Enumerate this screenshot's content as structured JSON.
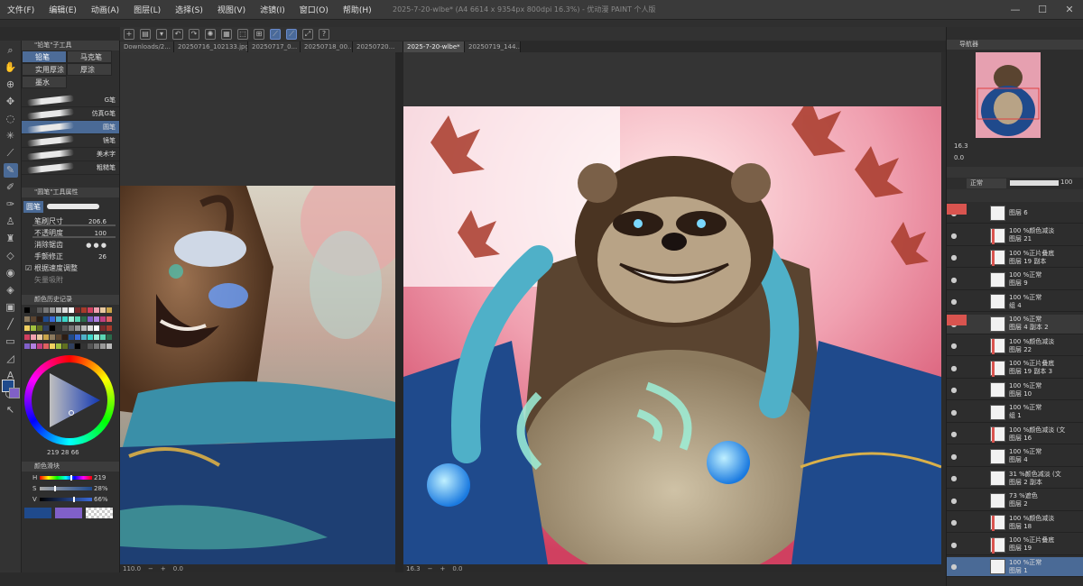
{
  "window": {
    "title": "2025-7-20-wlbe* (A4 6614 x 9354px 800dpi 16.3%) - 优动漫 PAINT 个人版"
  },
  "menu": [
    "文件(F)",
    "编辑(E)",
    "动画(A)",
    "图层(L)",
    "选择(S)",
    "视图(V)",
    "滤镜(I)",
    "窗口(O)",
    "帮助(H)"
  ],
  "window_controls": {
    "minimize": "—",
    "maximize": "☐",
    "close": "✕"
  },
  "sub_tool": {
    "header": "\"铅笔\"子工具",
    "tabs": [
      {
        "label": "铅笔",
        "selected": true
      },
      {
        "label": "马克笔"
      },
      {
        "label": "实用厚涂"
      },
      {
        "label": "厚涂"
      },
      {
        "label": "墨水"
      }
    ],
    "brushes": [
      {
        "label": "G笔"
      },
      {
        "label": "仿真G笔"
      },
      {
        "label": "圆笔",
        "selected": true
      },
      {
        "label": "镜笔"
      },
      {
        "label": "美术字"
      },
      {
        "label": "粗糙笔"
      }
    ]
  },
  "tool_property": {
    "header": "\"圆笔\"工具属性",
    "preset_label": "圆笔",
    "brush_size": {
      "label": "笔刷尺寸",
      "value": "206.6"
    },
    "opacity": {
      "label": "不透明度",
      "value": "100"
    },
    "anti_alias": {
      "label": "消除锯齿"
    },
    "stabilization": {
      "label": "手颤修正",
      "value": "26"
    },
    "speed": {
      "label": "根据速度调整"
    },
    "vector": {
      "label": "矢量吸附"
    }
  },
  "color_history": {
    "header": "颜色历史记录"
  },
  "color_wheel": {
    "readout": "219  28  66"
  },
  "color_slider": {
    "header": "颜色滑块",
    "h": {
      "label": "H",
      "value": "219",
      "fill": 0.61
    },
    "s": {
      "label": "S",
      "value": "28%",
      "fill": 0.28
    },
    "v": {
      "label": "V",
      "value": "66%",
      "fill": 0.66
    }
  },
  "colors": {
    "main": "#1f4a8c",
    "sub": "#8060c8",
    "accent": "#4a6a96",
    "record": "#d9544f"
  },
  "canvas_tabs": [
    "Downloads/2...",
    "20250716_102133.jpg",
    "20250717_0...",
    "20250718_00...",
    "20250720...",
    "2025-7-20-wlbe*",
    "20250719_144..."
  ],
  "status_left": {
    "zoom": "110.0",
    "angle": "0.0"
  },
  "status_right": {
    "zoom": "16.3",
    "angle": "0.0"
  },
  "navigator": {
    "header": "导航器",
    "zoom": "16.3",
    "angle": "0.0"
  },
  "layer_panel": {
    "blend_mode": "正常",
    "opacity": "100",
    "layers": [
      {
        "line1": "图层 6",
        "line2": ""
      },
      {
        "line1": "100 %颜色减淡",
        "line2": "图层 21"
      },
      {
        "line1": "100 %正片叠底",
        "line2": "图层 19 副本"
      },
      {
        "line1": "100 %正常",
        "line2": "图层 9"
      },
      {
        "line1": "100 %正常",
        "line2": "组 4"
      },
      {
        "line1": "100 %正常",
        "line2": "图层 4 副本 2"
      },
      {
        "line1": "100 %颜色减淡",
        "line2": "图层 22"
      },
      {
        "line1": "100 %正片叠底",
        "line2": "图层 19 副本 3"
      },
      {
        "line1": "100 %正常",
        "line2": "图层 10"
      },
      {
        "line1": "100 %正常",
        "line2": "组 1"
      },
      {
        "line1": "100 %颜色减淡 (文",
        "line2": "图层 16"
      },
      {
        "line1": "100 %正常",
        "line2": "图层 4"
      },
      {
        "line1": "31 %颜色减淡 (文",
        "line2": "图层 2 副本"
      },
      {
        "line1": "73 %遮色",
        "line2": "图层 2"
      },
      {
        "line1": "100 %颜色减淡",
        "line2": "图层 18"
      },
      {
        "line1": "100 %正片叠底",
        "line2": "图层 19"
      },
      {
        "line1": "100 %正常",
        "line2": "图层 1"
      }
    ]
  }
}
